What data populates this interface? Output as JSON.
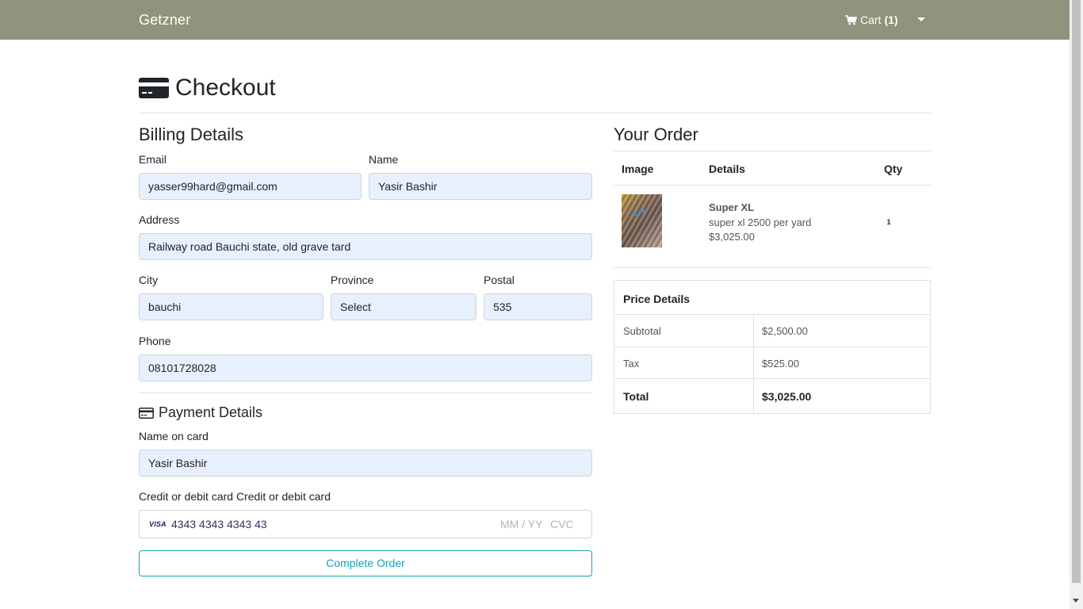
{
  "navbar": {
    "brand": "Getzner",
    "cart_label": "Cart",
    "cart_count": "(1)"
  },
  "page": {
    "title": "Checkout"
  },
  "billing": {
    "heading": "Billing Details",
    "email_label": "Email",
    "email_value": "yasser99hard@gmail.com",
    "name_label": "Name",
    "name_value": "Yasir Bashir",
    "address_label": "Address",
    "address_value": "Railway road Bauchi state, old grave tard",
    "city_label": "City",
    "city_value": "bauchi",
    "province_label": "Province",
    "province_value": "Select",
    "postal_label": "Postal",
    "postal_value": "535",
    "phone_label": "Phone",
    "phone_value": "08101728028"
  },
  "payment": {
    "heading": "Payment Details",
    "name_on_card_label": "Name on card",
    "name_on_card_value": "Yasir Bashir",
    "card_label": "Credit or debit card Credit or debit card",
    "card_brand": "VISA",
    "card_number": "4343 4343 4343 43",
    "exp_placeholder": "MM / YY",
    "cvc_placeholder": "CVC",
    "submit_label": "Complete Order"
  },
  "order": {
    "heading": "Your Order",
    "columns": [
      "Image",
      "Details",
      "Qty"
    ],
    "items": [
      {
        "name": "Super XL",
        "description": "super xl 2500 per yard",
        "price": "$3,025.00",
        "qty": "1"
      }
    ]
  },
  "price_details": {
    "heading": "Price Details",
    "rows": [
      {
        "label": "Subtotal",
        "value": "$2,500.00"
      },
      {
        "label": "Tax",
        "value": "$525.00"
      },
      {
        "label": "Total",
        "value": "$3,025.00"
      }
    ]
  },
  "colors": {
    "navbar": "#92937c",
    "input_bg": "#e8f0fe",
    "button_accent": "#17a2b8"
  }
}
